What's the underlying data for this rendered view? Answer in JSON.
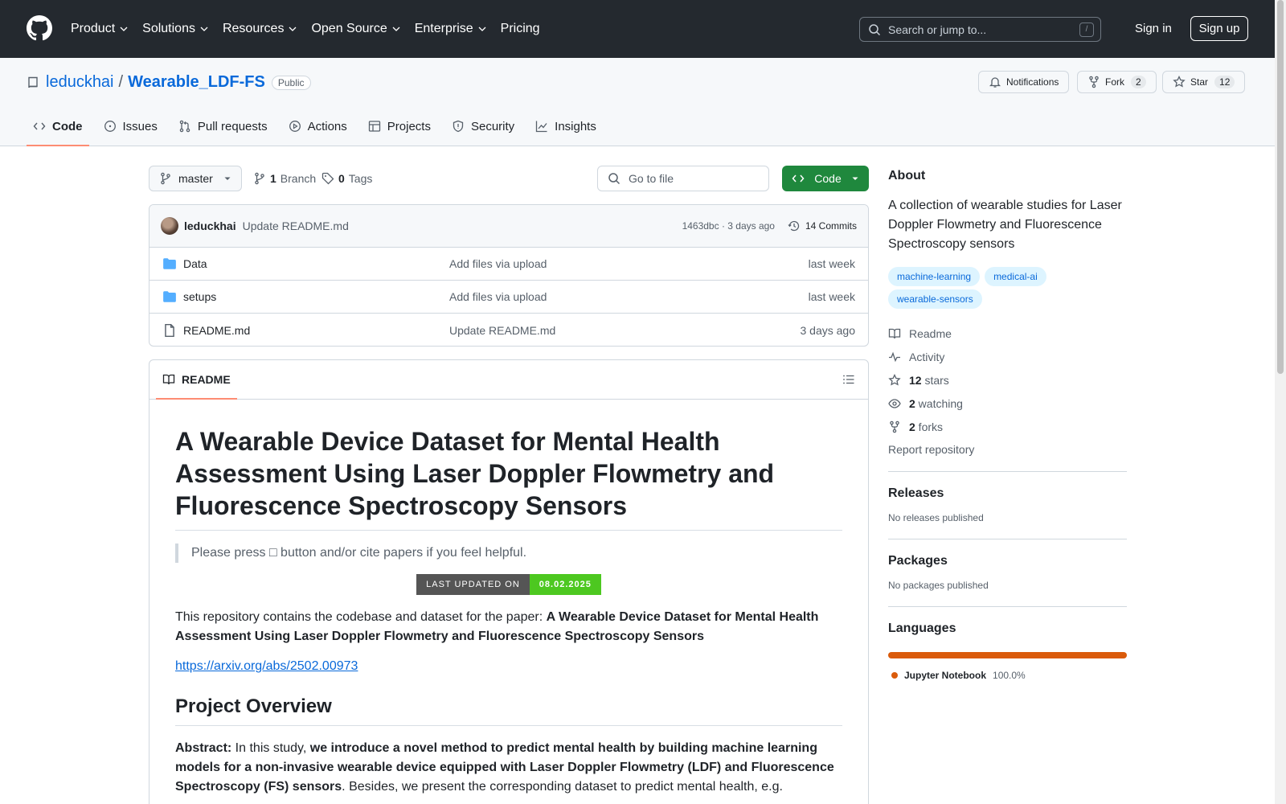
{
  "header": {
    "nav": [
      "Product",
      "Solutions",
      "Resources",
      "Open Source",
      "Enterprise",
      "Pricing"
    ],
    "search_placeholder": "Search or jump to...",
    "search_shortcut": "/",
    "signin": "Sign in",
    "signup": "Sign up"
  },
  "repo": {
    "owner": "leduckhai",
    "separator": "/",
    "name": "Wearable_LDF-FS",
    "visibility": "Public",
    "notifications_label": "Notifications",
    "fork_label": "Fork",
    "fork_count": "2",
    "star_label": "Star",
    "star_count": "12",
    "tabs": [
      "Code",
      "Issues",
      "Pull requests",
      "Actions",
      "Projects",
      "Security",
      "Insights"
    ]
  },
  "toolbar": {
    "branch": "master",
    "branch_count": "1",
    "branch_label": "Branch",
    "tag_count": "0",
    "tag_label": "Tags",
    "goto_file": "Go to file",
    "code_button": "Code"
  },
  "commit": {
    "author": "leduckhai",
    "message": "Update README.md",
    "meta": "1463dbc · 3 days ago",
    "commits": "14 Commits"
  },
  "files": [
    {
      "name": "Data",
      "type": "folder",
      "message": "Add files via upload",
      "date": "last week"
    },
    {
      "name": "setups",
      "type": "folder",
      "message": "Add files via upload",
      "date": "last week"
    },
    {
      "name": "README.md",
      "type": "file",
      "message": "Update README.md",
      "date": "3 days ago"
    }
  ],
  "readme": {
    "tab_label": "README",
    "title": "A Wearable Device Dataset for Mental Health Assessment Using Laser Doppler Flowmetry and Fluorescence Spectroscopy Sensors",
    "quote_before": "Please press ",
    "quote_glyph": "□",
    "quote_after": " button and/or cite papers if you feel helpful.",
    "badge_left": "LAST UPDATED ON",
    "badge_right": "08.02.2025",
    "intro": "This repository contains the codebase and dataset for the paper: ",
    "intro_bold": "A Wearable Device Dataset for Mental Health Assessment Using Laser Doppler Flowmetry and Fluorescence Spectroscopy Sensors",
    "arxiv_link": "https://arxiv.org/abs/2502.00973",
    "overview_heading": "Project Overview",
    "abstract_label": "Abstract:",
    "abstract_text1": " In this study, ",
    "abstract_bold": "we introduce a novel method to predict mental health by building machine learning models for a non-invasive wearable device equipped with Laser Doppler Flowmetry (LDF) and Fluorescence Spectroscopy (FS) sensors",
    "abstract_text2": ". Besides, we present the corresponding dataset to predict mental health, e.g."
  },
  "sidebar": {
    "about_heading": "About",
    "description": "A collection of wearable studies for Laser Doppler Flowmetry and Fluorescence Spectroscopy sensors",
    "topics": [
      "machine-learning",
      "medical-ai",
      "wearable-sensors"
    ],
    "links": [
      {
        "icon": "book-icon",
        "bold": "",
        "text": "Readme"
      },
      {
        "icon": "pulse-icon",
        "bold": "",
        "text": "Activity"
      },
      {
        "icon": "star-icon",
        "bold": "12",
        "text": " stars"
      },
      {
        "icon": "eye-icon",
        "bold": "2",
        "text": " watching"
      },
      {
        "icon": "fork-icon",
        "bold": "2",
        "text": " forks"
      }
    ],
    "report": "Report repository",
    "releases_heading": "Releases",
    "releases_text": "No releases published",
    "packages_heading": "Packages",
    "packages_text": "No packages published",
    "languages_heading": "Languages",
    "language_name": "Jupyter Notebook",
    "language_pct": "100.0%",
    "language_color": "#da5b0b"
  }
}
